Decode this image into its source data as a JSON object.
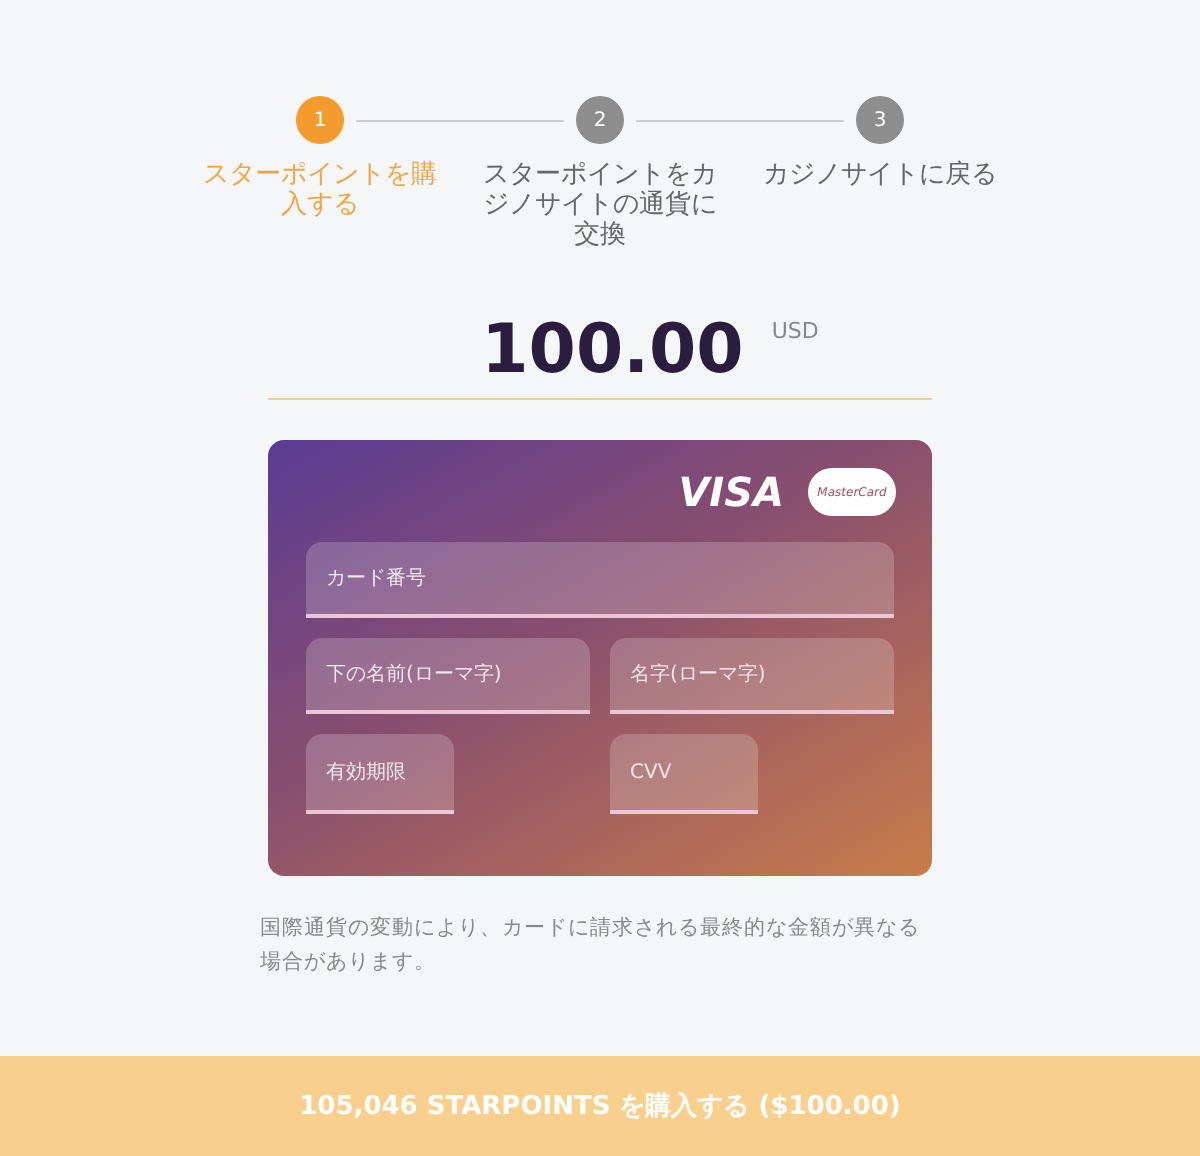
{
  "steps": [
    {
      "number": "1",
      "label": "スターポイントを購入する",
      "selected": true
    },
    {
      "number": "2",
      "label": "スターポイントをカジノサイトの通貨に交換",
      "selected": false
    },
    {
      "number": "3",
      "label": "カジノサイトに戻る",
      "selected": false
    }
  ],
  "amount": {
    "value": "100.00",
    "currency": "USD"
  },
  "card": {
    "brands": [
      "VISA",
      "MasterCard"
    ],
    "fields": [
      {
        "placeholder": "カード番号",
        "kind": "wide"
      },
      {
        "placeholder": "下の名前(ローマ字)",
        "kind": "half"
      },
      {
        "placeholder": "名字(ローマ字)",
        "kind": "half"
      },
      {
        "placeholder": "有効期限",
        "kind": "short"
      },
      {
        "placeholder": "CVV",
        "kind": "short"
      }
    ]
  },
  "note": "国際通貨の変動により、カードに請求される最終的な金額が異なる場合があります。",
  "buy_button": "105,046 STARPOINTS を購入する ($100.00)"
}
